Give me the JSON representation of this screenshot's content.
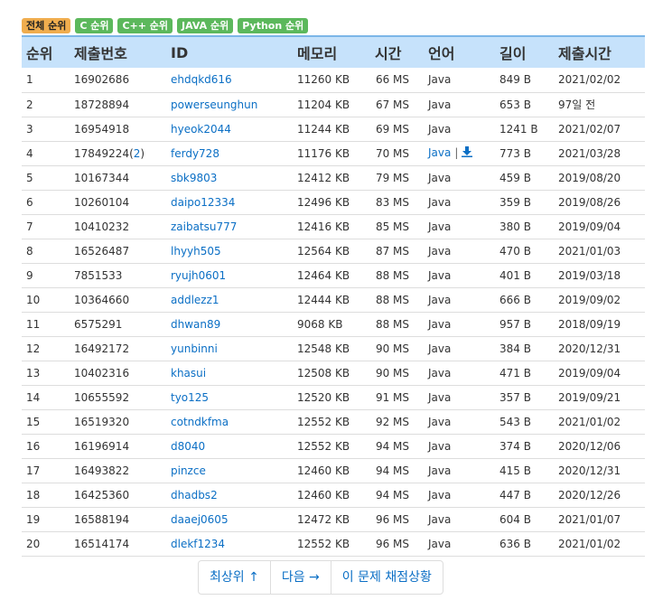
{
  "filters": [
    {
      "label": "전체 순위",
      "active": true
    },
    {
      "label": "C 순위",
      "active": false
    },
    {
      "label": "C++ 순위",
      "active": false
    },
    {
      "label": "JAVA 순위",
      "active": false
    },
    {
      "label": "Python 순위",
      "active": false
    }
  ],
  "table": {
    "headers": [
      "순위",
      "제출번호",
      "ID",
      "메모리",
      "시간",
      "언어",
      "길이",
      "제출시간"
    ],
    "rows": [
      {
        "rank": "1",
        "submission": "16902686",
        "sub_extra": "",
        "id": "ehdqkd616",
        "memory": "11260 KB",
        "time": "66 MS",
        "lang": "Java",
        "lang_link": false,
        "length": "849 B",
        "submitted": "2021/02/02"
      },
      {
        "rank": "2",
        "submission": "18728894",
        "sub_extra": "",
        "id": "powerseunghun",
        "memory": "11204 KB",
        "time": "67 MS",
        "lang": "Java",
        "lang_link": false,
        "length": "653 B",
        "submitted": "97일 전"
      },
      {
        "rank": "3",
        "submission": "16954918",
        "sub_extra": "",
        "id": "hyeok2044",
        "memory": "11244 KB",
        "time": "69 MS",
        "lang": "Java",
        "lang_link": false,
        "length": "1241 B",
        "submitted": "2021/02/07"
      },
      {
        "rank": "4",
        "submission": "17849224(",
        "sub_extra": "2",
        "sub_close": ")",
        "id": "ferdy728",
        "memory": "11176 KB",
        "time": "70 MS",
        "lang": "Java",
        "lang_link": true,
        "length": "773 B",
        "submitted": "2021/03/28"
      },
      {
        "rank": "5",
        "submission": "10167344",
        "sub_extra": "",
        "id": "sbk9803",
        "memory": "12412 KB",
        "time": "79 MS",
        "lang": "Java",
        "lang_link": false,
        "length": "459 B",
        "submitted": "2019/08/20"
      },
      {
        "rank": "6",
        "submission": "10260104",
        "sub_extra": "",
        "id": "daipo12334",
        "memory": "12496 KB",
        "time": "83 MS",
        "lang": "Java",
        "lang_link": false,
        "length": "359 B",
        "submitted": "2019/08/26"
      },
      {
        "rank": "7",
        "submission": "10410232",
        "sub_extra": "",
        "id": "zaibatsu777",
        "memory": "12416 KB",
        "time": "85 MS",
        "lang": "Java",
        "lang_link": false,
        "length": "380 B",
        "submitted": "2019/09/04"
      },
      {
        "rank": "8",
        "submission": "16526487",
        "sub_extra": "",
        "id": "lhyyh505",
        "memory": "12564 KB",
        "time": "87 MS",
        "lang": "Java",
        "lang_link": false,
        "length": "470 B",
        "submitted": "2021/01/03"
      },
      {
        "rank": "9",
        "submission": "7851533",
        "sub_extra": "",
        "id": "ryujh0601",
        "memory": "12464 KB",
        "time": "88 MS",
        "lang": "Java",
        "lang_link": false,
        "length": "401 B",
        "submitted": "2019/03/18"
      },
      {
        "rank": "10",
        "submission": "10364660",
        "sub_extra": "",
        "id": "addlezz1",
        "memory": "12444 KB",
        "time": "88 MS",
        "lang": "Java",
        "lang_link": false,
        "length": "666 B",
        "submitted": "2019/09/02"
      },
      {
        "rank": "11",
        "submission": "6575291",
        "sub_extra": "",
        "id": "dhwan89",
        "memory": "9068 KB",
        "time": "88 MS",
        "lang": "Java",
        "lang_link": false,
        "length": "957 B",
        "submitted": "2018/09/19"
      },
      {
        "rank": "12",
        "submission": "16492172",
        "sub_extra": "",
        "id": "yunbinni",
        "memory": "12548 KB",
        "time": "90 MS",
        "lang": "Java",
        "lang_link": false,
        "length": "384 B",
        "submitted": "2020/12/31"
      },
      {
        "rank": "13",
        "submission": "10402316",
        "sub_extra": "",
        "id": "khasui",
        "memory": "12508 KB",
        "time": "90 MS",
        "lang": "Java",
        "lang_link": false,
        "length": "471 B",
        "submitted": "2019/09/04"
      },
      {
        "rank": "14",
        "submission": "10655592",
        "sub_extra": "",
        "id": "tyo125",
        "memory": "12520 KB",
        "time": "91 MS",
        "lang": "Java",
        "lang_link": false,
        "length": "357 B",
        "submitted": "2019/09/21"
      },
      {
        "rank": "15",
        "submission": "16519320",
        "sub_extra": "",
        "id": "cotndkfma",
        "memory": "12552 KB",
        "time": "92 MS",
        "lang": "Java",
        "lang_link": false,
        "length": "543 B",
        "submitted": "2021/01/02"
      },
      {
        "rank": "16",
        "submission": "16196914",
        "sub_extra": "",
        "id": "d8040",
        "memory": "12552 KB",
        "time": "94 MS",
        "lang": "Java",
        "lang_link": false,
        "length": "374 B",
        "submitted": "2020/12/06"
      },
      {
        "rank": "17",
        "submission": "16493822",
        "sub_extra": "",
        "id": "pinzce",
        "memory": "12460 KB",
        "time": "94 MS",
        "lang": "Java",
        "lang_link": false,
        "length": "415 B",
        "submitted": "2020/12/31"
      },
      {
        "rank": "18",
        "submission": "16425360",
        "sub_extra": "",
        "id": "dhadbs2",
        "memory": "12460 KB",
        "time": "94 MS",
        "lang": "Java",
        "lang_link": false,
        "length": "447 B",
        "submitted": "2020/12/26"
      },
      {
        "rank": "19",
        "submission": "16588194",
        "sub_extra": "",
        "id": "daaej0605",
        "memory": "12472 KB",
        "time": "96 MS",
        "lang": "Java",
        "lang_link": false,
        "length": "604 B",
        "submitted": "2021/01/07"
      },
      {
        "rank": "20",
        "submission": "16514174",
        "sub_extra": "",
        "id": "dlekf1234",
        "memory": "12552 KB",
        "time": "96 MS",
        "lang": "Java",
        "lang_link": false,
        "length": "636 B",
        "submitted": "2021/01/02"
      }
    ]
  },
  "lang_separator": "|",
  "pager": {
    "top": "최상위 ↑",
    "next": "다음 →",
    "status": "이 문제 채점상황"
  },
  "colors": {
    "link": "#0b6fc5",
    "header_bg": "#c6e2fb",
    "badge_active": "#f0ad4e",
    "badge": "#5cb85c"
  },
  "icons": {
    "download": "download-icon"
  }
}
